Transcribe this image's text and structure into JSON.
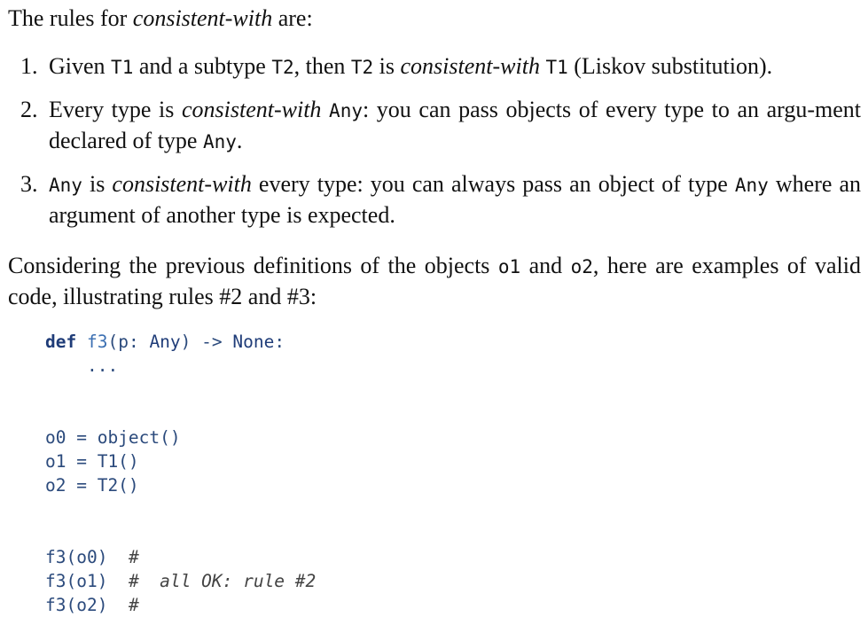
{
  "intro": {
    "prefix": "The rules for ",
    "term": "consistent-with",
    "suffix": " are:"
  },
  "rules": [
    {
      "number": "1.",
      "p1": "Given ",
      "c1": "T1",
      "p2": " and a subtype ",
      "c2": "T2",
      "p3": ", then ",
      "c3": "T2",
      "p4": " is ",
      "term": "consistent-with",
      "p5": " ",
      "c4": "T1",
      "p6": " (Liskov substitution)."
    },
    {
      "number": "2.",
      "p1": "Every type is ",
      "term": "consistent-with",
      "p2": " ",
      "c1": "Any",
      "p3": ": you can pass objects of every type to an argu-ment declared of type ",
      "c2": "Any",
      "p4": "."
    },
    {
      "number": "3.",
      "c1": "Any",
      "p1": " is ",
      "term": "consistent-with",
      "p2": " every type: you can always pass an object of type ",
      "c2": "Any",
      "p3": " where an argument of another type is expected."
    }
  ],
  "consider": {
    "p1": "Considering the previous definitions of the objects ",
    "c1": "o1",
    "p2": " and ",
    "c2": "o2",
    "p3": ", here are examples of valid code, illustrating rules #2 and #3:"
  },
  "code": {
    "line1_kw": "def",
    "line1_fn": "f3",
    "line1_rest_a": "(p: ",
    "line1_type": "Any",
    "line1_rest_b": ") -> ",
    "line1_ret": "None",
    "line1_end": ":",
    "line2": "    ...",
    "assign": [
      "o0 = object()",
      "o1 = T1()",
      "o2 = T2()"
    ],
    "calls": [
      {
        "call": "f3(o0)",
        "hash": "#",
        "comment": ""
      },
      {
        "call": "f3(o1)",
        "hash": "#",
        "comment": "all OK: rule #2"
      },
      {
        "call": "f3(o2)",
        "hash": "#",
        "comment": ""
      }
    ]
  }
}
